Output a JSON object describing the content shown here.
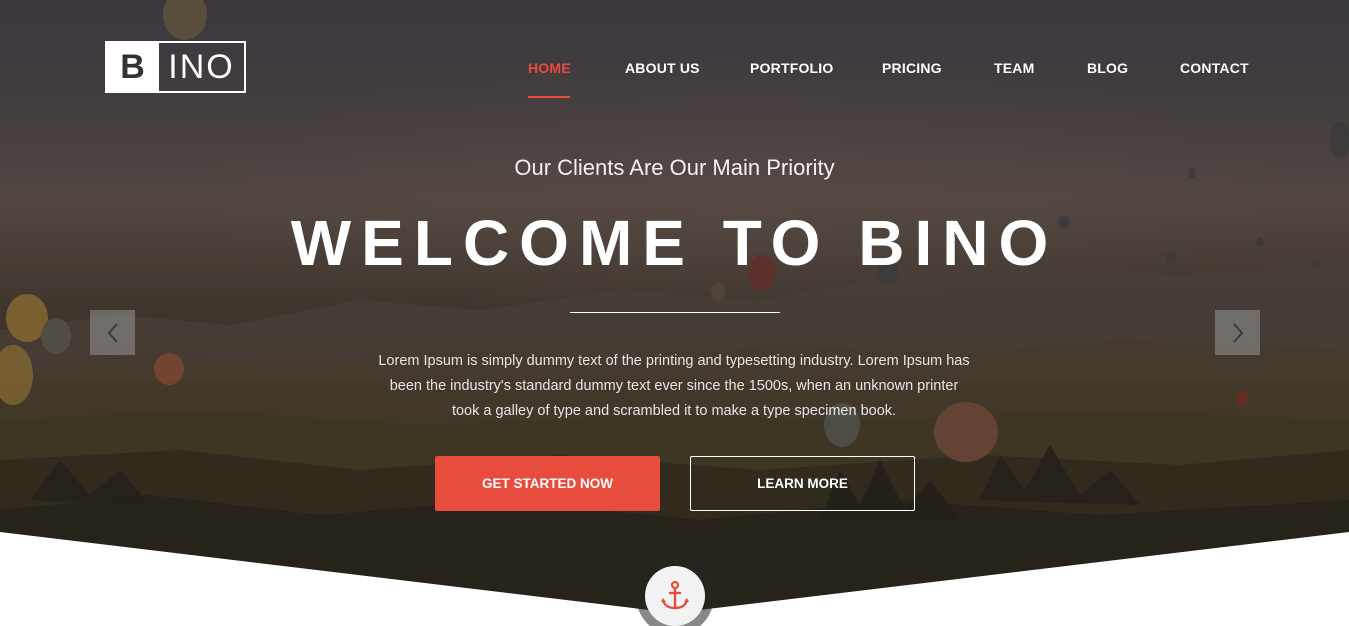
{
  "logo": {
    "letter": "B",
    "rest": "INO"
  },
  "nav": {
    "items": [
      {
        "label": "HOME",
        "active": true
      },
      {
        "label": "ABOUT US",
        "active": false
      },
      {
        "label": "PORTFOLIO",
        "active": false
      },
      {
        "label": "PRICING",
        "active": false
      },
      {
        "label": "TEAM",
        "active": false
      },
      {
        "label": "BLOG",
        "active": false
      },
      {
        "label": "CONTACT",
        "active": false
      }
    ]
  },
  "hero": {
    "subtitle": "Our Clients Are Our Main Priority",
    "title": "WELCOME TO BINO",
    "description": "Lorem Ipsum is simply dummy text of the printing and typesetting industry. Lorem Ipsum has been the industry's standard dummy text ever since the 1500s, when an unknown printer took a galley of type and scrambled it to make a type specimen book.",
    "primary_button": "GET STARTED NOW",
    "secondary_button": "LEARN MORE"
  },
  "slider": {
    "prev_icon": "chevron-left-icon",
    "next_icon": "chevron-right-icon"
  },
  "badge": {
    "icon": "anchor-icon"
  },
  "colors": {
    "accent": "#e74c3c",
    "text": "#ffffff"
  }
}
